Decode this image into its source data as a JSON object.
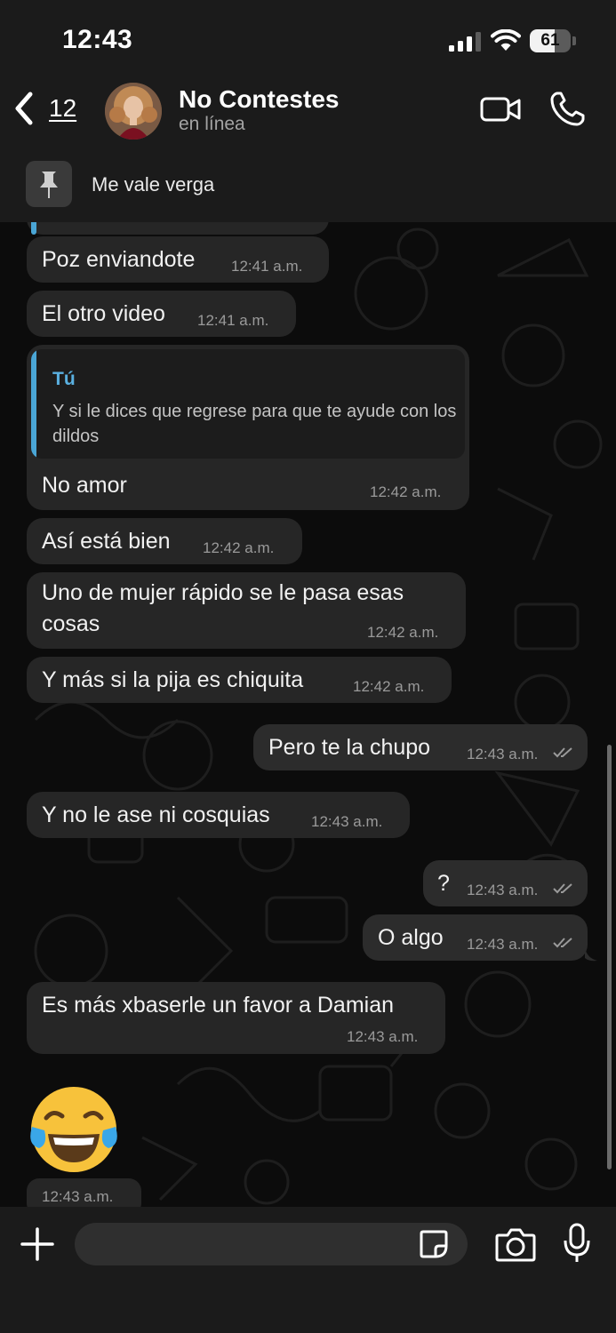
{
  "status_bar": {
    "time": "12:43",
    "battery": "61"
  },
  "header": {
    "back_count": "12",
    "contact_name": "No Contestes",
    "presence": "en línea"
  },
  "pinned": {
    "text": "Me vale verga"
  },
  "messages": [
    {
      "text": "Poz enviandote",
      "time": "12:41 a.m."
    },
    {
      "text": "El otro video",
      "time": "12:41 a.m."
    },
    {
      "quote_author": "Tú",
      "quote_text": "Y si le dices que regrese para que te ayude con los dildos",
      "text": "No amor",
      "time": "12:42 a.m."
    },
    {
      "text": "Así está bien",
      "time": "12:42 a.m."
    },
    {
      "text": "Uno de mujer rápido se le pasa esas cosas",
      "time": "12:42 a.m."
    },
    {
      "text": "Y más si la pija es chiquita",
      "time": "12:42 a.m."
    },
    {
      "text": "Pero te la chupo",
      "time": "12:43 a.m."
    },
    {
      "text": "Y no le ase ni cosquias",
      "time": "12:43 a.m."
    },
    {
      "text": "?",
      "time": "12:43 a.m."
    },
    {
      "text": "O algo",
      "time": "12:43 a.m."
    },
    {
      "text": "Es más xbaserle un favor a Damian",
      "time": "12:43 a.m."
    },
    {
      "emoji": "face-with-tears-of-joy",
      "time": "12:43 a.m."
    }
  ],
  "icons": {
    "back": "chevron-left-icon",
    "video": "video-camera-icon",
    "call": "phone-icon",
    "pin": "pin-icon",
    "plus": "plus-icon",
    "sticker": "sticker-icon",
    "camera": "camera-icon",
    "mic": "microphone-icon",
    "read": "double-check-icon"
  },
  "colors": {
    "background": "#0b0b0b",
    "bar": "#1b1b1b",
    "bubble": "#262626",
    "quote_accent": "#4aa6d6"
  },
  "input": {
    "value": ""
  }
}
